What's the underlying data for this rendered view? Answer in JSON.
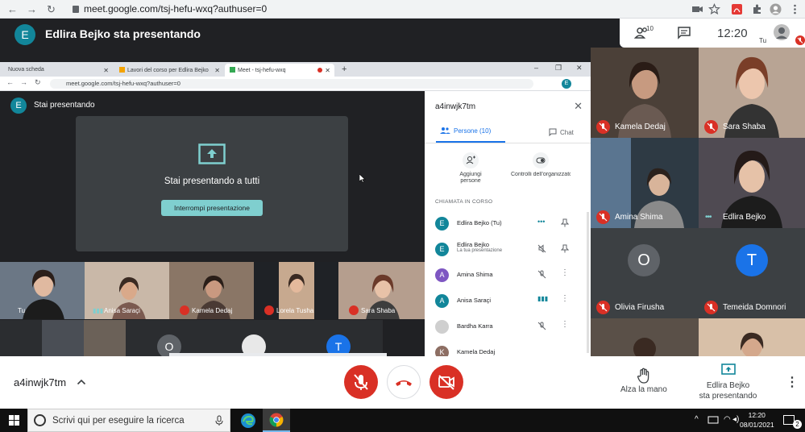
{
  "browser": {
    "url": "meet.google.com/tsj-hefu-wxq?authuser=0"
  },
  "header": {
    "avatar_letter": "E",
    "title": "Edlira Bejko sta presentando",
    "participant_count": "10",
    "clock": "12:20",
    "self_label": "Tu"
  },
  "inner_browser": {
    "tabs": [
      {
        "label": "Nuova scheda"
      },
      {
        "label": "Lavori del corso per Edlira Bejko"
      },
      {
        "label": "Meet - tsj-hefu-wxq"
      }
    ],
    "url": "meet.google.com/tsj-hefu-wxq?authuser=0",
    "avatar_letter": "E"
  },
  "presenting": {
    "avatar_letter": "E",
    "label": "Stai presentando",
    "message": "Stai presentando a tutti",
    "stop_button": "Interrompi presentazione"
  },
  "inner_tiles": [
    {
      "name": "Tu"
    },
    {
      "name": "Anisa Saraçi"
    },
    {
      "name": "Kamela Dedaj"
    },
    {
      "name": "Lorela Tusha"
    },
    {
      "name": "Sara Shaba"
    }
  ],
  "inner_tiles_row2": [
    {
      "letter": "O"
    },
    {
      "letter": "T"
    }
  ],
  "panel": {
    "title": "a4inwjk7tm",
    "tab_people": "Persone (10)",
    "tab_chat": "Chat",
    "add_people": "Aggiungi persone",
    "host_controls": "Controlli dell'organizzatore",
    "section": "CHIAMATA IN CORSO",
    "people": [
      {
        "letter": "E",
        "name": "Edlira Bejko (Tu)",
        "sub": "",
        "color": "#12869a"
      },
      {
        "letter": "E",
        "name": "Edlira Bejko",
        "sub": "La tua presentazione",
        "color": "#12869a"
      },
      {
        "letter": "A",
        "name": "Amina Shima",
        "sub": "",
        "color": "#7e57c2"
      },
      {
        "letter": "A",
        "name": "Anisa Saraçi",
        "sub": "",
        "color": "#12869a"
      },
      {
        "letter": "",
        "name": "Bardha Karra",
        "sub": "",
        "color": "#cfcfcf"
      },
      {
        "letter": "K",
        "name": "Kamela Dedaj",
        "sub": "",
        "color": "#8d6e63"
      }
    ]
  },
  "right_grid": [
    {
      "name": "Kamela Dedaj",
      "letter": ""
    },
    {
      "name": "Sara Shaba",
      "letter": ""
    },
    {
      "name": "Amina Shima",
      "letter": ""
    },
    {
      "name": "Edlira Bejko",
      "letter": ""
    },
    {
      "name": "Olivia Firusha",
      "letter": "O"
    },
    {
      "name": "Temeida Domnori",
      "letter": "T"
    }
  ],
  "bottom": {
    "meeting_code": "a4inwjk7tm",
    "raise_hand": "Alza la mano",
    "presenting_line1": "Edlira Bejko",
    "presenting_line2": "sta presentando"
  },
  "taskbar": {
    "search_placeholder": "Scrivi qui per eseguire la ricerca",
    "time": "12:20",
    "date": "08/01/2021",
    "notifications": "2"
  },
  "colors": {
    "meet_dark": "#202124",
    "tile": "#3c4043",
    "danger": "#d93025",
    "accent": "#1a73e8",
    "teal": "#12869a"
  }
}
